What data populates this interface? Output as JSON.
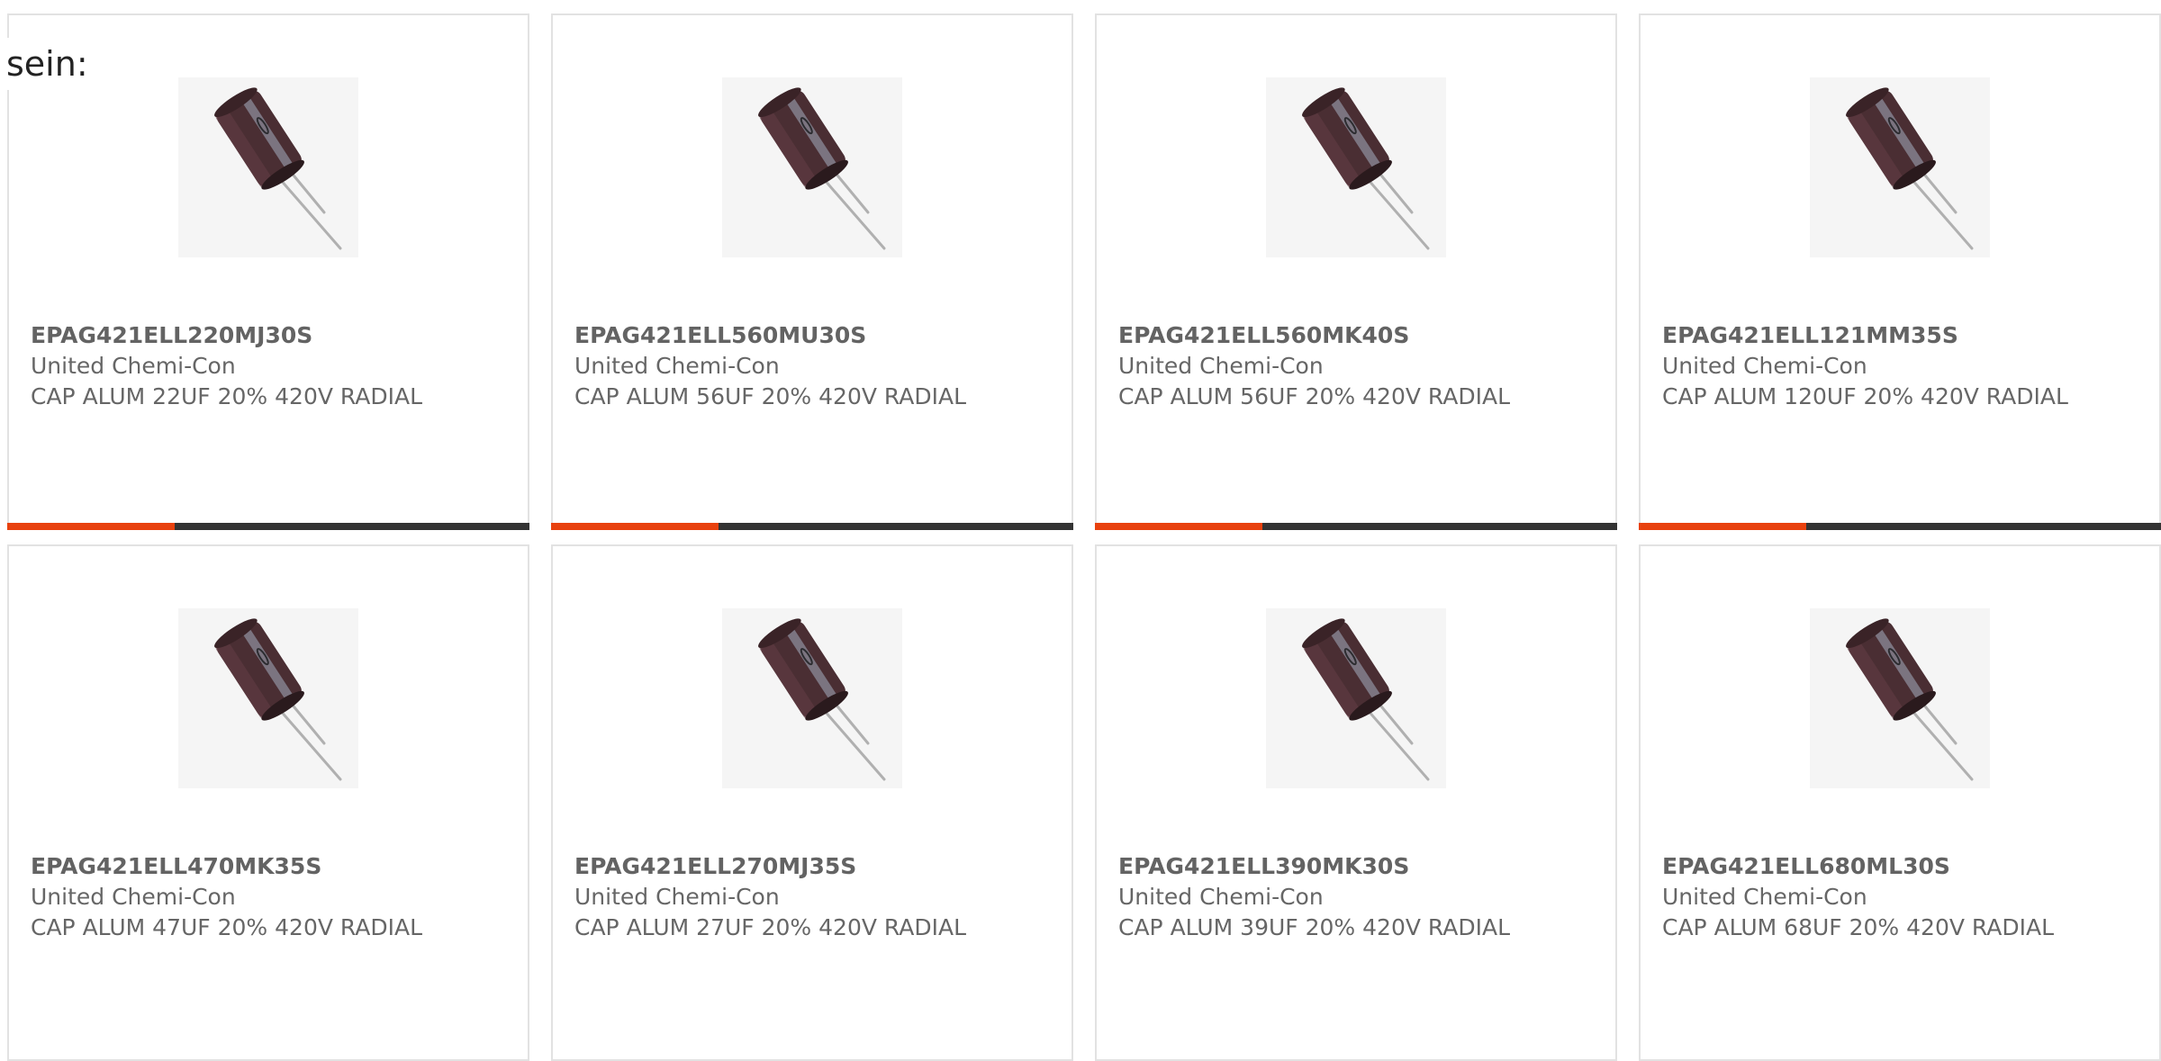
{
  "intro_text": "sein:",
  "colors": {
    "accent_bar": "#e8410e",
    "bar_track": "#333333",
    "card_border": "#e2e2e2",
    "text": "#666666"
  },
  "products": [
    {
      "part_number": "EPAG421ELL220MJ30S",
      "manufacturer": "United Chemi-Con",
      "description": "CAP ALUM 22UF 20% 420V RADIAL",
      "image_icon": "radial-electrolytic-capacitor-icon"
    },
    {
      "part_number": "EPAG421ELL560MU30S",
      "manufacturer": "United Chemi-Con",
      "description": "CAP ALUM 56UF 20% 420V RADIAL",
      "image_icon": "radial-electrolytic-capacitor-icon"
    },
    {
      "part_number": "EPAG421ELL560MK40S",
      "manufacturer": "United Chemi-Con",
      "description": "CAP ALUM 56UF 20% 420V RADIAL",
      "image_icon": "radial-electrolytic-capacitor-icon"
    },
    {
      "part_number": "EPAG421ELL121MM35S",
      "manufacturer": "United Chemi-Con",
      "description": "CAP ALUM 120UF 20% 420V RADIAL",
      "image_icon": "radial-electrolytic-capacitor-icon"
    },
    {
      "part_number": "EPAG421ELL470MK35S",
      "manufacturer": "United Chemi-Con",
      "description": "CAP ALUM 47UF 20% 420V RADIAL",
      "image_icon": "radial-electrolytic-capacitor-icon"
    },
    {
      "part_number": "EPAG421ELL270MJ35S",
      "manufacturer": "United Chemi-Con",
      "description": "CAP ALUM 27UF 20% 420V RADIAL",
      "image_icon": "radial-electrolytic-capacitor-icon"
    },
    {
      "part_number": "EPAG421ELL390MK30S",
      "manufacturer": "United Chemi-Con",
      "description": "CAP ALUM 39UF 20% 420V RADIAL",
      "image_icon": "radial-electrolytic-capacitor-icon"
    },
    {
      "part_number": "EPAG421ELL680ML30S",
      "manufacturer": "United Chemi-Con",
      "description": "CAP ALUM 68UF 20% 420V RADIAL",
      "image_icon": "radial-electrolytic-capacitor-icon"
    }
  ],
  "row1_bar_fill_fraction": 0.32
}
